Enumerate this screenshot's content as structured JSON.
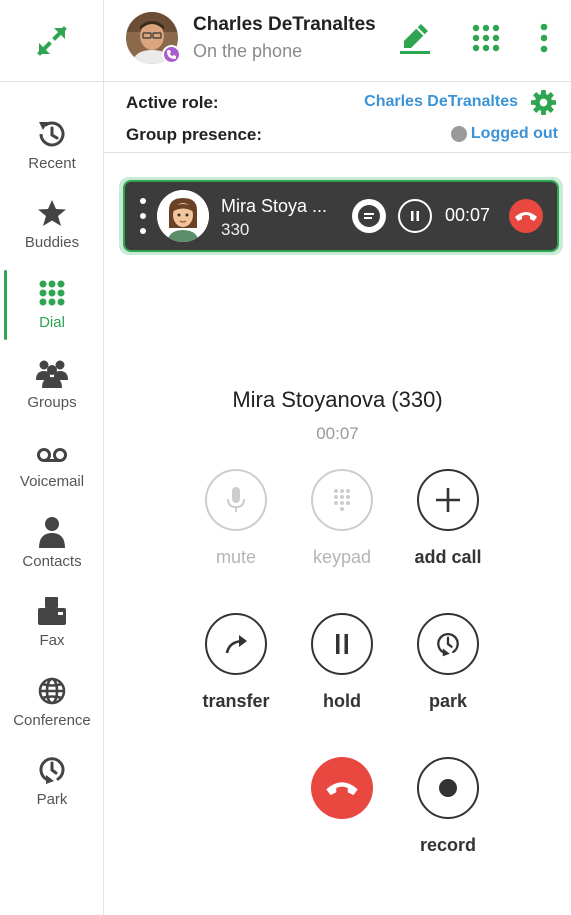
{
  "header": {
    "user_name": "Charles DeTranaltes",
    "user_status": "On the phone"
  },
  "sidebar": {
    "items": [
      {
        "label": "Recent",
        "icon": "history-icon"
      },
      {
        "label": "Buddies",
        "icon": "star-icon"
      },
      {
        "label": "Dial",
        "icon": "dialpad-icon",
        "active": true
      },
      {
        "label": "Groups",
        "icon": "groups-icon"
      },
      {
        "label": "Voicemail",
        "icon": "voicemail-icon"
      },
      {
        "label": "Contacts",
        "icon": "contact-icon"
      },
      {
        "label": "Fax",
        "icon": "fax-icon"
      },
      {
        "label": "Conference",
        "icon": "globe-icon"
      },
      {
        "label": "Park",
        "icon": "park-icon"
      }
    ]
  },
  "roles": {
    "active_role_label": "Active role:",
    "active_role_value": "Charles DeTranaltes",
    "group_presence_label": "Group presence:",
    "group_presence_value": "Logged out"
  },
  "active_call": {
    "name": "Mira Stoya ...",
    "extension": "330",
    "timer": "00:07"
  },
  "call_panel": {
    "remote_name": "Mira Stoyanova (330)",
    "timer": "00:07",
    "controls": {
      "mute": "mute",
      "keypad": "keypad",
      "add_call": "add call",
      "transfer": "transfer",
      "hold": "hold",
      "park": "park",
      "record": "record"
    }
  },
  "colors": {
    "accent_green": "#2ea550",
    "link_blue": "#3c93d6",
    "hangup_red": "#e8483f",
    "call_bar_dark": "#3c3c3c",
    "status_purple": "#a95ccc"
  }
}
